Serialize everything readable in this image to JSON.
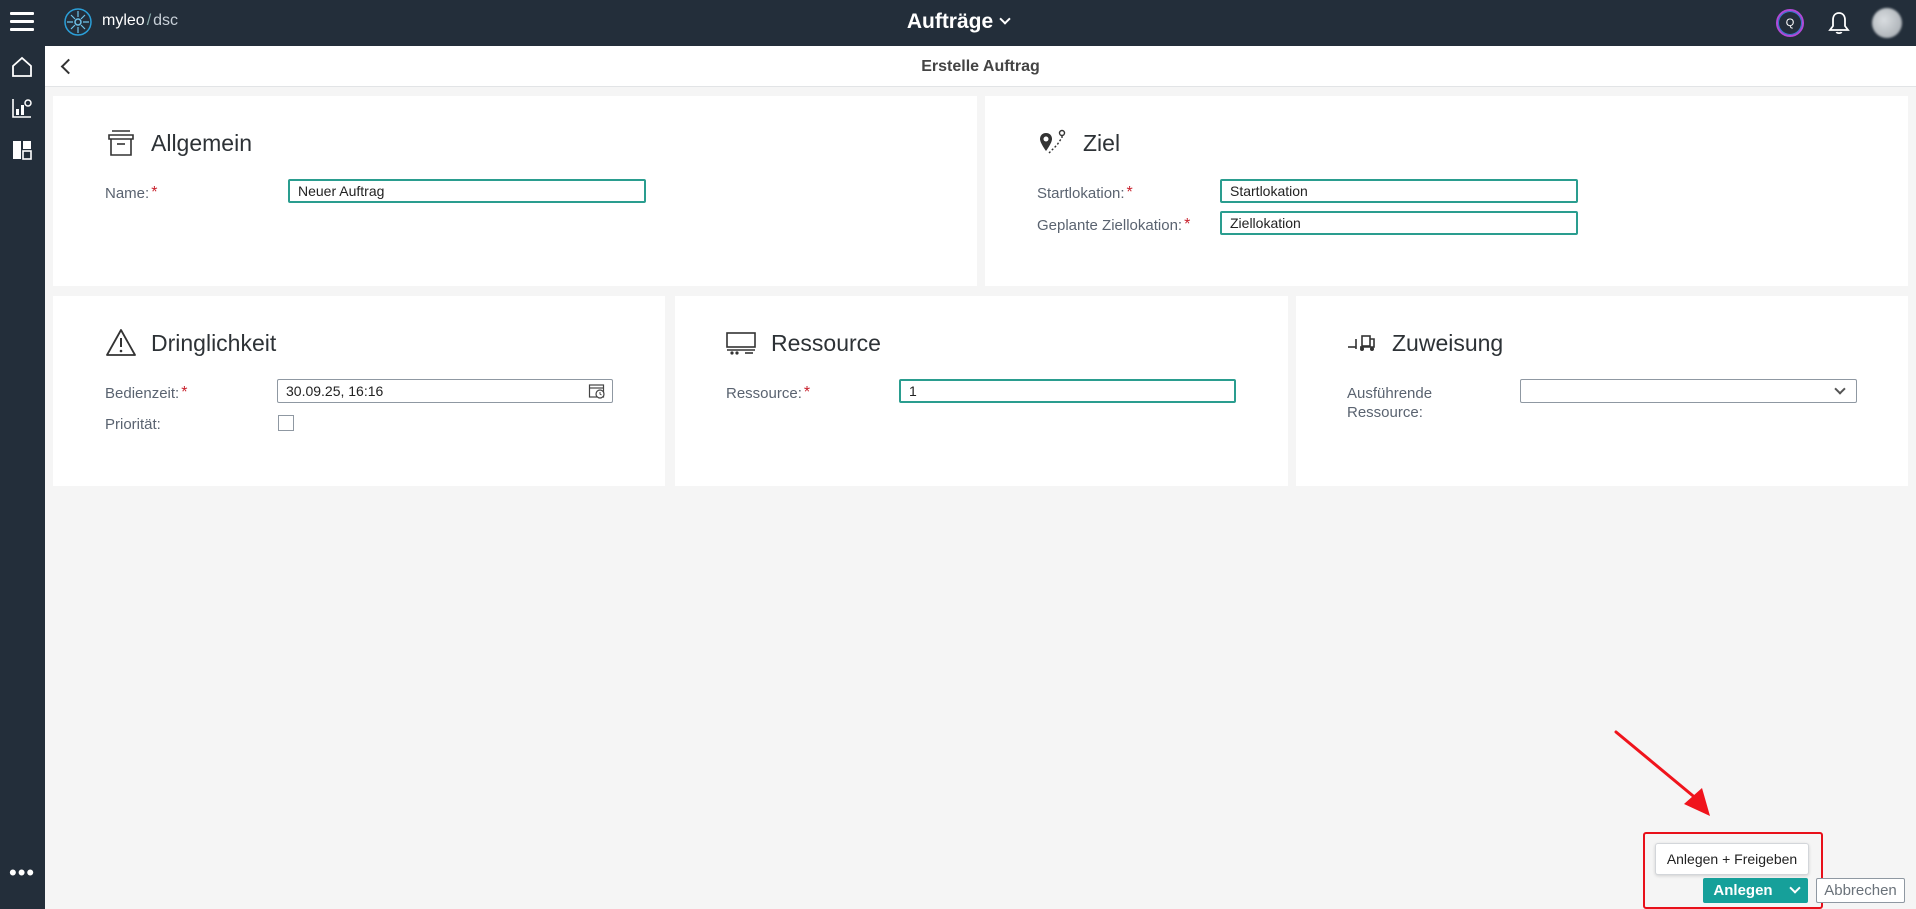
{
  "topbar": {
    "brand_name": "myleo",
    "brand_sep": "/",
    "brand_suffix": "dsc",
    "title": "Aufträge",
    "q_badge": "Q"
  },
  "subheader": {
    "title": "Erstelle Auftrag"
  },
  "sections": {
    "allgemein": {
      "title": "Allgemein",
      "name_label": "Name:",
      "name_value": "Neuer Auftrag"
    },
    "ziel": {
      "title": "Ziel",
      "start_label": "Startlokation:",
      "start_value": "Startlokation",
      "ziel_label": "Geplante Ziellokation:",
      "ziel_value": "Ziellokation"
    },
    "dringlichkeit": {
      "title": "Dringlichkeit",
      "bedienzeit_label": "Bedienzeit:",
      "bedienzeit_value": "30.09.25, 16:16",
      "prioritaet_label": "Priorität:",
      "prioritaet_checked": false
    },
    "ressource": {
      "title": "Ressource",
      "ressource_label": "Ressource:",
      "ressource_value": "1"
    },
    "zuweisung": {
      "title": "Zuweisung",
      "ausfuehrende_label_line1": "Ausführende",
      "ausfuehrende_label_line2": "Ressource:",
      "ausfuehrende_value": ""
    }
  },
  "required_marker": "*",
  "actions": {
    "popover_item": "Anlegen + Freigeben",
    "primary": "Anlegen",
    "secondary": "Abbrechen"
  },
  "colors": {
    "topbar_bg": "#232e3a",
    "accent": "#16a09a",
    "input_border": "#2a9d8f",
    "required": "#c8202c",
    "highlight": "#e8101a"
  }
}
